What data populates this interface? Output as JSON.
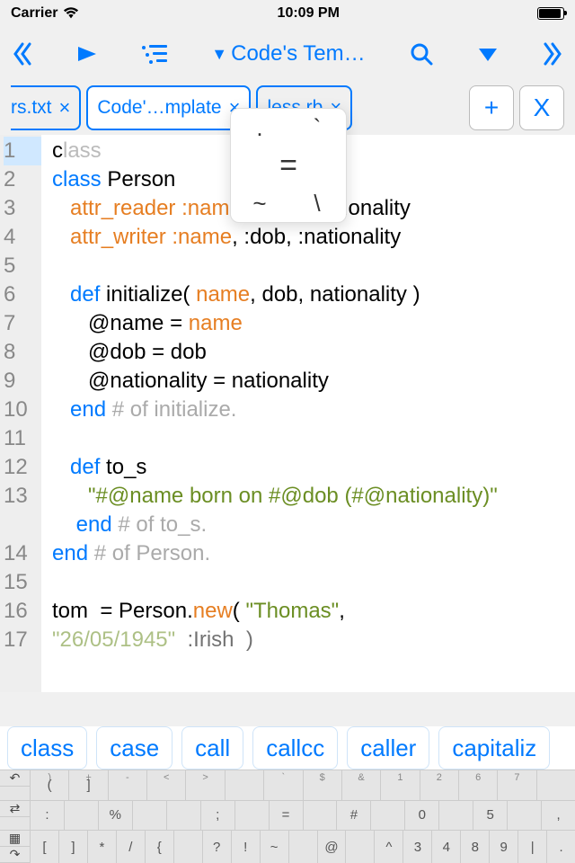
{
  "status": {
    "carrier": "Carrier",
    "time": "10:09 PM"
  },
  "toolbar": {
    "title": "Code's Tem…"
  },
  "tabs": [
    {
      "label": "rs.txt",
      "close": "×",
      "active": false,
      "cut": "left"
    },
    {
      "label": "Code'…mplate",
      "close": "×",
      "active": true
    },
    {
      "label": "less.rb",
      "close": "×",
      "active": false
    }
  ],
  "tab_actions": {
    "add": "+",
    "close": "X"
  },
  "popup": {
    "dot": ".",
    "backtick": "`",
    "eq": "=",
    "tilde": "~",
    "backslash": "\\"
  },
  "gutter": [
    "1",
    "2",
    "3",
    "4",
    "5",
    "6",
    "7",
    "8",
    "9",
    "10",
    "11",
    "12",
    "13",
    "",
    "14",
    "15",
    "16",
    "17"
  ],
  "code": {
    "l1a": "c",
    "l1b": "lass",
    "l2a": "class",
    "l2b": " Person",
    "l3a": "   ",
    "l3b": "attr_reader",
    "l3c": " ",
    "l3d": ":name",
    "l3e": ", :dob, :nationality",
    "l4a": "   ",
    "l4b": "attr_writer",
    "l4c": " ",
    "l4d": ":name",
    "l4e": ", :dob, :nationality",
    "l6a": "   ",
    "l6b": "def",
    "l6c": " initialize( ",
    "l6d": "name",
    "l6e": ", dob, nationality )",
    "l7a": "      @name = ",
    "l7b": "name",
    "l8": "      @dob = dob",
    "l9": "      @nationality = nationality",
    "l10a": "   ",
    "l10b": "end",
    "l10c": " ",
    "l10d": "# of initialize.",
    "l12a": "   ",
    "l12b": "def",
    "l12c": " to_s",
    "l13a": "      ",
    "l13b": "\"#@name born on #@dob (#@nationality)\"",
    "l14a": "    ",
    "l14b": "end",
    "l14c": " ",
    "l14d": "# of to_s.",
    "l15a": "",
    "l15b": "end",
    "l15c": " ",
    "l15d": "# of Person.",
    "l17a": "tom  = Person.",
    "l17b": "new",
    "l17c": "( ",
    "l17d": "\"Thomas\"",
    "l17e": ",",
    "l18a": "\"26/05/1945\"",
    "l18b": "  :Irish  )"
  },
  "suggestions": [
    "class",
    "case",
    "call",
    "callcc",
    "caller",
    "capitaliz"
  ],
  "kbd_rows": [
    [
      {
        "t": ")",
        "m": "("
      },
      {
        "t": "+",
        "m": "]"
      },
      {
        "t": "-",
        "m": ""
      },
      {
        "t": "<",
        "m": ""
      },
      {
        "t": ">",
        "m": ""
      },
      {
        "t": "",
        "m": ""
      },
      {
        "t": "`",
        "m": ""
      },
      {
        "t": "$",
        "m": ""
      },
      {
        "t": "&",
        "m": ""
      },
      {
        "t": "1",
        "m": ""
      },
      {
        "t": "2",
        "m": ""
      },
      {
        "t": "6",
        "m": ""
      },
      {
        "t": "7",
        "m": ""
      },
      {
        "t": "",
        "m": ""
      }
    ],
    [
      {
        "m": ":"
      },
      {
        "m": ""
      },
      {
        "m": "%"
      },
      {
        "m": ""
      },
      {
        "m": ""
      },
      {
        "m": ";"
      },
      {
        "m": ""
      },
      {
        "m": "="
      },
      {
        "m": ""
      },
      {
        "m": "#"
      },
      {
        "m": ""
      },
      {
        "m": "0"
      },
      {
        "m": ""
      },
      {
        "m": "5"
      },
      {
        "m": ""
      },
      {
        "m": ","
      }
    ],
    [
      {
        "m": "["
      },
      {
        "m": "]"
      },
      {
        "m": "*"
      },
      {
        "m": "/"
      },
      {
        "m": "{"
      },
      {
        "m": ""
      },
      {
        "m": "?"
      },
      {
        "m": "!"
      },
      {
        "m": "~"
      },
      {
        "m": ""
      },
      {
        "m": "@"
      },
      {
        "m": ""
      },
      {
        "m": "^"
      },
      {
        "m": "3"
      },
      {
        "m": "4"
      },
      {
        "m": "8"
      },
      {
        "m": "9"
      },
      {
        "m": "|"
      },
      {
        "m": "."
      }
    ]
  ]
}
